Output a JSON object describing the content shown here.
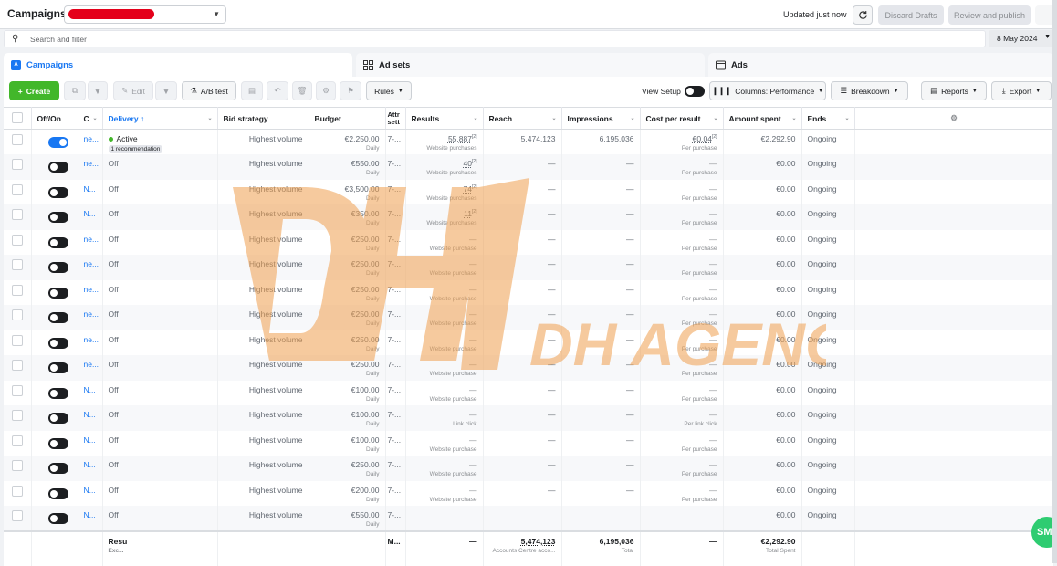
{
  "header": {
    "title": "Campaigns",
    "updated": "Updated just now",
    "discard": "Discard Drafts",
    "review": "Review and publish",
    "more": "···"
  },
  "search": {
    "placeholder": "Search and filter"
  },
  "date": "8 May 2024",
  "tabs": [
    {
      "label": "Campaigns"
    },
    {
      "label": "Ad sets"
    },
    {
      "label": "Ads"
    }
  ],
  "toolbar": {
    "create": "Create",
    "edit": "Edit",
    "ab_test": "A/B test",
    "rules": "Rules",
    "view_setup": "View Setup",
    "columns": "Columns: Performance",
    "breakdown": "Breakdown",
    "reports": "Reports",
    "export": "Export"
  },
  "columns": [
    "Off/On",
    "C",
    "Delivery ↑",
    "Bid strategy",
    "Budget",
    "Attr sett",
    "Results",
    "Reach",
    "Impressions",
    "Cost per result",
    "Amount spent",
    "Ends"
  ],
  "rows": [
    {
      "on": true,
      "name": "ne...",
      "delivery": "Active",
      "rec": "1 recommendation",
      "bid": "Highest volume",
      "budget": "€2,250.00",
      "attr": "7-...",
      "results": "55,887",
      "results_sub": "Website purchases",
      "reach": "5,474,123",
      "impr": "6,195,036",
      "cpr": "€0.04",
      "cpr_sub": "Per purchase",
      "spent": "€2,292.90",
      "ends": "Ongoing"
    },
    {
      "on": false,
      "name": "ne...",
      "delivery": "Off",
      "bid": "Highest volume",
      "budget": "€550.00",
      "attr": "7-...",
      "results": "40",
      "results_sub": "Website purchases",
      "reach": "—",
      "impr": "—",
      "cpr": "—",
      "cpr_sub": "Per purchase",
      "spent": "€0.00",
      "ends": "Ongoing"
    },
    {
      "on": false,
      "name": "N...",
      "delivery": "Off",
      "bid": "Highest volume",
      "budget": "€3,500.00",
      "attr": "7-...",
      "results": "74",
      "results_sub": "Website purchases",
      "reach": "—",
      "impr": "—",
      "cpr": "—",
      "cpr_sub": "Per purchase",
      "spent": "€0.00",
      "ends": "Ongoing"
    },
    {
      "on": false,
      "name": "N...",
      "delivery": "Off",
      "bid": "Highest volume",
      "budget": "€350.00",
      "attr": "7-...",
      "results": "11",
      "results_sub": "Website purchases",
      "reach": "—",
      "impr": "—",
      "cpr": "—",
      "cpr_sub": "Per purchase",
      "spent": "€0.00",
      "ends": "Ongoing"
    },
    {
      "on": false,
      "name": "ne...",
      "delivery": "Off",
      "bid": "Highest volume",
      "budget": "€250.00",
      "attr": "7-...",
      "results": "—",
      "results_sub": "Website purchase",
      "reach": "—",
      "impr": "—",
      "cpr": "—",
      "cpr_sub": "Per purchase",
      "spent": "€0.00",
      "ends": "Ongoing"
    },
    {
      "on": false,
      "name": "ne...",
      "delivery": "Off",
      "bid": "Highest volume",
      "budget": "€250.00",
      "attr": "7-...",
      "results": "—",
      "results_sub": "Website purchase",
      "reach": "—",
      "impr": "—",
      "cpr": "—",
      "cpr_sub": "Per purchase",
      "spent": "€0.00",
      "ends": "Ongoing"
    },
    {
      "on": false,
      "name": "ne...",
      "delivery": "Off",
      "bid": "Highest volume",
      "budget": "€250.00",
      "attr": "7-...",
      "results": "—",
      "results_sub": "Website purchase",
      "reach": "—",
      "impr": "—",
      "cpr": "—",
      "cpr_sub": "Per purchase",
      "spent": "€0.00",
      "ends": "Ongoing"
    },
    {
      "on": false,
      "name": "ne...",
      "delivery": "Off",
      "bid": "Highest volume",
      "budget": "€250.00",
      "attr": "7-...",
      "results": "—",
      "results_sub": "Website purchase",
      "reach": "—",
      "impr": "—",
      "cpr": "—",
      "cpr_sub": "Per purchase",
      "spent": "€0.00",
      "ends": "Ongoing"
    },
    {
      "on": false,
      "name": "ne...",
      "delivery": "Off",
      "bid": "Highest volume",
      "budget": "€250.00",
      "attr": "7-...",
      "results": "—",
      "results_sub": "Website purchase",
      "reach": "—",
      "impr": "—",
      "cpr": "—",
      "cpr_sub": "Per purchase",
      "spent": "€0.00",
      "ends": "Ongoing"
    },
    {
      "on": false,
      "name": "ne...",
      "delivery": "Off",
      "bid": "Highest volume",
      "budget": "€250.00",
      "attr": "7-...",
      "results": "—",
      "results_sub": "Website purchase",
      "reach": "—",
      "impr": "—",
      "cpr": "—",
      "cpr_sub": "Per purchase",
      "spent": "€0.00",
      "ends": "Ongoing"
    },
    {
      "on": false,
      "name": "N...",
      "delivery": "Off",
      "bid": "Highest volume",
      "budget": "€100.00",
      "attr": "7-...",
      "results": "—",
      "results_sub": "Website purchase",
      "reach": "—",
      "impr": "—",
      "cpr": "—",
      "cpr_sub": "Per purchase",
      "spent": "€0.00",
      "ends": "Ongoing"
    },
    {
      "on": false,
      "name": "N...",
      "delivery": "Off",
      "bid": "Highest volume",
      "budget": "€100.00",
      "attr": "7-...",
      "results": "—",
      "results_sub": "Link click",
      "reach": "—",
      "impr": "—",
      "cpr": "—",
      "cpr_sub": "Per link click",
      "spent": "€0.00",
      "ends": "Ongoing"
    },
    {
      "on": false,
      "name": "N...",
      "delivery": "Off",
      "bid": "Highest volume",
      "budget": "€100.00",
      "attr": "7-...",
      "results": "—",
      "results_sub": "Website purchase",
      "reach": "—",
      "impr": "—",
      "cpr": "—",
      "cpr_sub": "Per purchase",
      "spent": "€0.00",
      "ends": "Ongoing"
    },
    {
      "on": false,
      "name": "N...",
      "delivery": "Off",
      "bid": "Highest volume",
      "budget": "€250.00",
      "attr": "7-...",
      "results": "—",
      "results_sub": "Website purchase",
      "reach": "—",
      "impr": "—",
      "cpr": "—",
      "cpr_sub": "Per purchase",
      "spent": "€0.00",
      "ends": "Ongoing"
    },
    {
      "on": false,
      "name": "N...",
      "delivery": "Off",
      "bid": "Highest volume",
      "budget": "€200.00",
      "attr": "7-...",
      "results": "—",
      "results_sub": "Website purchase",
      "reach": "—",
      "impr": "—",
      "cpr": "—",
      "cpr_sub": "Per purchase",
      "spent": "€0.00",
      "ends": "Ongoing"
    },
    {
      "on": false,
      "name": "N...",
      "delivery": "Off",
      "bid": "Highest volume",
      "budget": "€550.00",
      "attr": "7-...",
      "results": "",
      "results_sub": "",
      "reach": "",
      "impr": "",
      "cpr": "",
      "cpr_sub": "",
      "spent": "€0.00",
      "ends": "Ongoing"
    }
  ],
  "footer": {
    "label": "Resu",
    "label_sub": "Exc...",
    "attr": "M...",
    "results": "—",
    "reach": "5,474,123",
    "reach_sub": "Accounts Centre acco...",
    "impr": "6,195,036",
    "impr_sub": "Total",
    "cpr": "—",
    "spent": "€2,292.90",
    "spent_sub": "Total Spent"
  },
  "watermark": {
    "brand": "DH AGENCY"
  },
  "smi": "SMI",
  "colors": {
    "accent": "#1877f2",
    "create": "#42b72a",
    "watermark": "#f0a050"
  }
}
